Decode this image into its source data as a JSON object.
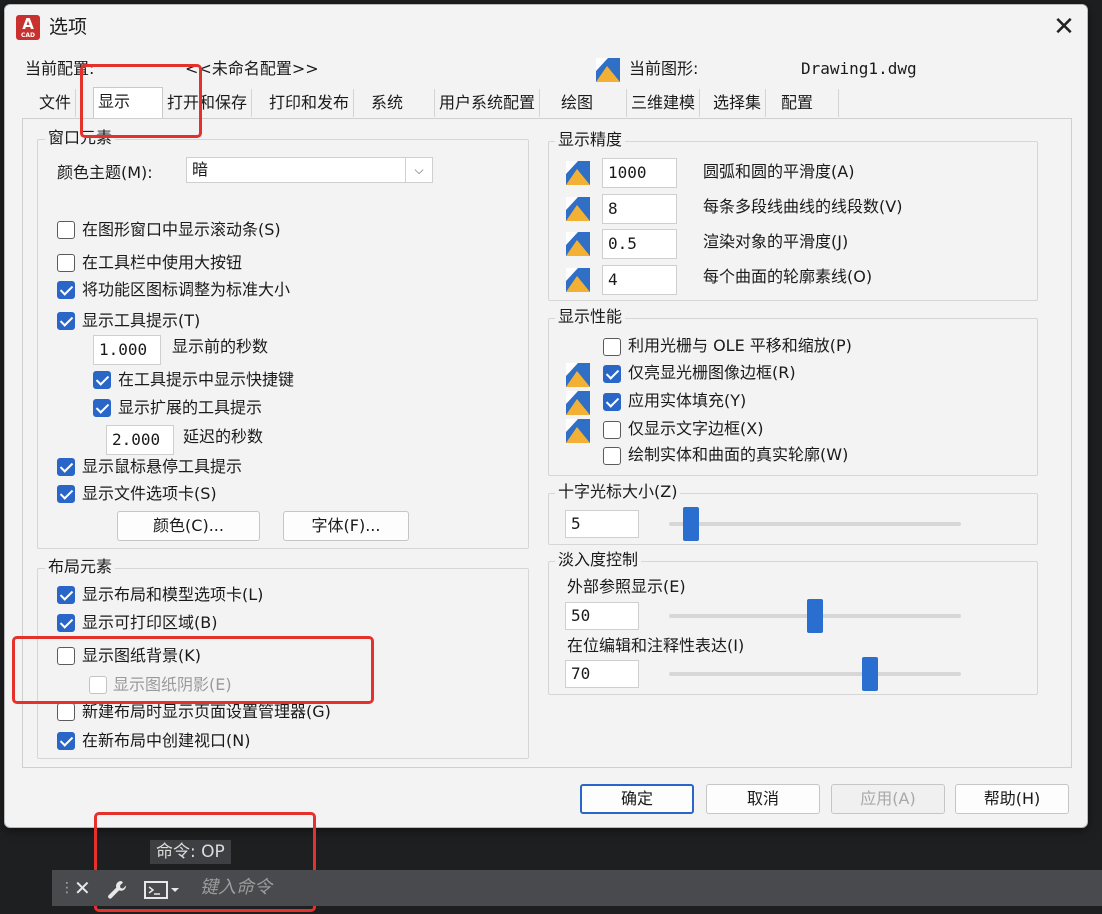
{
  "window": {
    "title": "选项",
    "app_icon_letter": "A",
    "app_icon_sub": "CAD",
    "close_glyph": "✕"
  },
  "header": {
    "profile_label": "当前配置:",
    "profile_value": "<<未命名配置>>",
    "drawing_label": "当前图形:",
    "drawing_value": "Drawing1.dwg"
  },
  "tabs": [
    {
      "label": "文件",
      "active": false
    },
    {
      "label": "显示",
      "active": true
    },
    {
      "label": "打开和保存",
      "active": false
    },
    {
      "label": "打印和发布",
      "active": false
    },
    {
      "label": "系统",
      "active": false
    },
    {
      "label": "用户系统配置",
      "active": false
    },
    {
      "label": "绘图",
      "active": false
    },
    {
      "label": "三维建模",
      "active": false
    },
    {
      "label": "选择集",
      "active": false
    },
    {
      "label": "配置",
      "active": false
    }
  ],
  "window_elements": {
    "title": "窗口元素",
    "color_theme_label": "颜色主题(M):",
    "color_theme_key": "M",
    "color_theme_value": "暗",
    "chk_scrollbars": {
      "label": "在图形窗口中显示滚动条(S)",
      "checked": false
    },
    "chk_large_buttons": {
      "label": "在工具栏中使用大按钮",
      "checked": false
    },
    "chk_resize_ribbon_icons": {
      "label": "将功能区图标调整为标准大小",
      "checked": true
    },
    "chk_tooltips": {
      "label": "显示工具提示(T)",
      "checked": true
    },
    "seconds_before_value": "1.000",
    "seconds_before_label": "显示前的秒数",
    "chk_shortcut_in_tooltips": {
      "label": "在工具提示中显示快捷键",
      "checked": true
    },
    "chk_extended_tooltips": {
      "label": "显示扩展的工具提示",
      "checked": true
    },
    "delay_seconds_value": "2.000",
    "delay_seconds_label": "延迟的秒数",
    "chk_rollover_tooltips": {
      "label": "显示鼠标悬停工具提示",
      "checked": true
    },
    "chk_file_tabs": {
      "label": "显示文件选项卡(S)",
      "checked": true
    },
    "colors_button": "颜色(C)...",
    "fonts_button": "字体(F)..."
  },
  "layout_elements": {
    "title": "布局元素",
    "chk_layout_model_tabs": {
      "label": "显示布局和模型选项卡(L)",
      "checked": true
    },
    "chk_printable_area": {
      "label": "显示可打印区域(B)",
      "checked": true
    },
    "chk_paper_background": {
      "label": "显示图纸背景(K)",
      "checked": false
    },
    "chk_paper_shadow": {
      "label": "显示图纸阴影(E)",
      "checked": false,
      "disabled": true
    },
    "chk_page_setup_manager": {
      "label": "新建布局时显示页面设置管理器(G)",
      "checked": false
    },
    "chk_create_viewport": {
      "label": "在新布局中创建视口(N)",
      "checked": true
    }
  },
  "display_resolution": {
    "title": "显示精度",
    "rows": [
      {
        "value": "1000",
        "label": "圆弧和圆的平滑度(A)"
      },
      {
        "value": "8",
        "label": "每条多段线曲线的线段数(V)"
      },
      {
        "value": "0.5",
        "label": "渲染对象的平滑度(J)"
      },
      {
        "value": "4",
        "label": "每个曲面的轮廓素线(O)"
      }
    ]
  },
  "display_performance": {
    "title": "显示性能",
    "items": [
      {
        "label": "利用光栅与 OLE 平移和缩放(P)",
        "checked": false,
        "icon": false
      },
      {
        "label": "仅亮显光栅图像边框(R)",
        "checked": true,
        "icon": true
      },
      {
        "label": "应用实体填充(Y)",
        "checked": true,
        "icon": true
      },
      {
        "label": "仅显示文字边框(X)",
        "checked": false,
        "icon": true
      },
      {
        "label": "绘制实体和曲面的真实轮廓(W)",
        "checked": false,
        "icon": false
      }
    ]
  },
  "crosshair": {
    "title": "十字光标大小(Z)",
    "value": "5",
    "level_fraction": 0.05
  },
  "fade_control": {
    "title": "淡入度控制",
    "xref_label": "外部参照显示(E)",
    "xref_value": "50",
    "xref_level_fraction": 0.5,
    "inplace_label": "在位编辑和注释性表达(I)",
    "inplace_value": "70",
    "inplace_level_fraction": 0.7
  },
  "footer": {
    "ok": "确定",
    "cancel": "取消",
    "apply": "应用(A)",
    "help": "帮助(H)"
  },
  "command_line": {
    "prompt": "命令: OP",
    "placeholder": "键入命令",
    "close_icon": "✕",
    "wrench_icon": "wrench-icon"
  },
  "colors": {
    "accent": "#2a66c8",
    "highlight": "#e4312b",
    "command_bar": "#484a4e"
  }
}
